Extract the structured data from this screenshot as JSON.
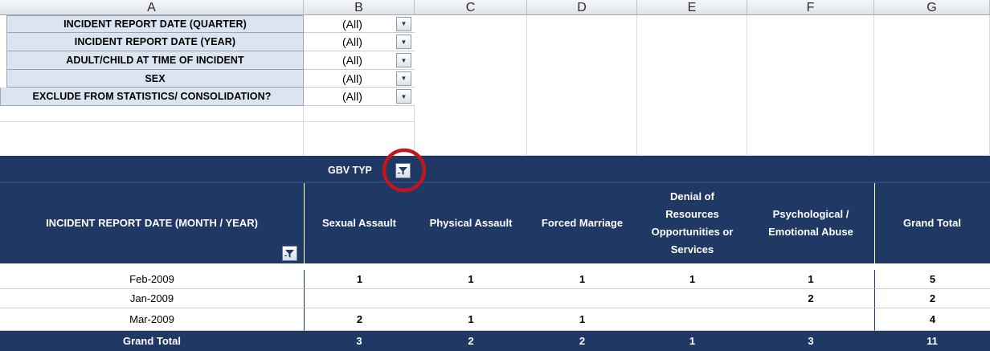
{
  "columns": [
    "A",
    "B",
    "C",
    "D",
    "E",
    "F",
    "G"
  ],
  "filters": [
    {
      "label": "INCIDENT REPORT DATE (QUARTER)",
      "value": "(All)"
    },
    {
      "label": "INCIDENT REPORT DATE (YEAR)",
      "value": "(All)"
    },
    {
      "label": "ADULT/CHILD AT TIME OF INCIDENT",
      "value": "(All)"
    },
    {
      "label": "SEX",
      "value": "(All)"
    },
    {
      "label": "EXCLUDE FROM STATISTICS/ CONSOLIDATION?",
      "value": "(All)"
    }
  ],
  "pivot": {
    "column_field": "GBV TYP",
    "row_header": "INCIDENT REPORT DATE (MONTH / YEAR)",
    "headers": [
      "Sexual Assault",
      "Physical Assault",
      "Forced Marriage",
      "Denial of Resources Opportunities or Services",
      "Psychological / Emotional Abuse",
      "Grand Total"
    ],
    "rows": [
      {
        "label": "Feb-2009",
        "values": [
          "1",
          "1",
          "1",
          "1",
          "1",
          "5"
        ]
      },
      {
        "label": "Jan-2009",
        "values": [
          "",
          "",
          "",
          "",
          "2",
          "2"
        ]
      },
      {
        "label": "Mar-2009",
        "values": [
          "2",
          "1",
          "1",
          "",
          "",
          "4"
        ]
      }
    ],
    "total": {
      "label": "Grand Total",
      "values": [
        "3",
        "2",
        "2",
        "1",
        "3",
        "11"
      ]
    }
  },
  "colors": {
    "navy": "#1f3864",
    "filter_label_bg": "#dbe5f1",
    "highlight_circle": "#c0161c"
  },
  "icons": {
    "dropdown": "dropdown-arrow-icon",
    "filter": "filter-funnel-icon"
  }
}
